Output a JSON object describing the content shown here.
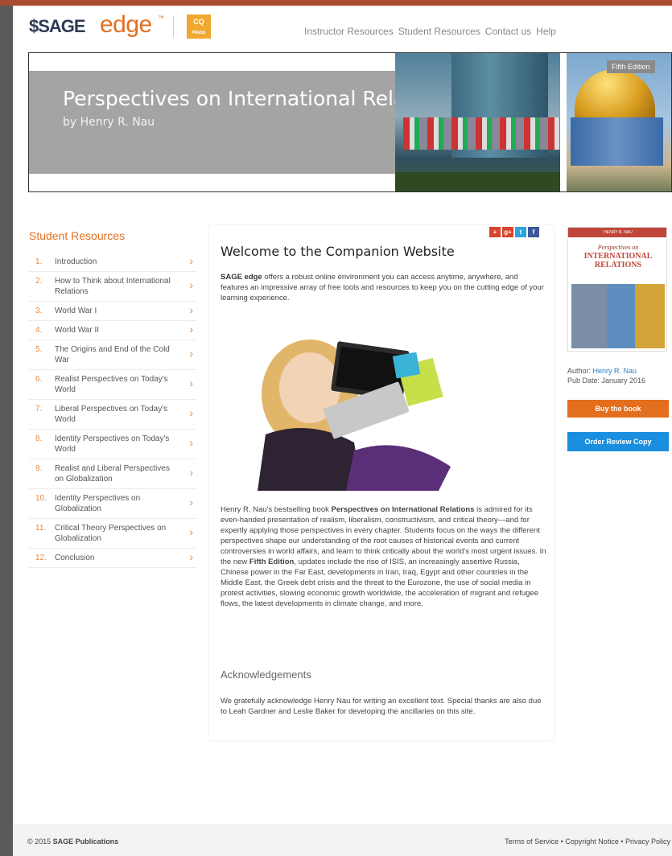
{
  "header": {
    "brand_sage": "SAGE",
    "brand_edge": "edge",
    "brand_tm": "™",
    "cq_logo": "CQ PRESS",
    "nav": [
      "Instructor Resources",
      "Student Resources",
      "Contact us",
      "Help"
    ]
  },
  "hero": {
    "title": "Perspectives on International Relations",
    "author": "by Henry R. Nau",
    "edition": "Fifth Edition"
  },
  "sidebar": {
    "title": "Student Resources",
    "items": [
      {
        "num": "1.",
        "label": "Introduction"
      },
      {
        "num": "2.",
        "label": "How to Think about International Relations"
      },
      {
        "num": "3.",
        "label": "World War I"
      },
      {
        "num": "4.",
        "label": "World War II"
      },
      {
        "num": "5.",
        "label": "The Origins and End of the Cold War"
      },
      {
        "num": "6.",
        "label": "Realist Perspectives on Today's World"
      },
      {
        "num": "7.",
        "label": "Liberal Perspectives on Today's World"
      },
      {
        "num": "8.",
        "label": "Identity Perspectives on Today's World"
      },
      {
        "num": "9.",
        "label": "Realist and Liberal Perspectives on Globalization"
      },
      {
        "num": "10.",
        "label": "Identity Perspectives on Globalization"
      },
      {
        "num": "11.",
        "label": "Critical Theory Perspectives on Globalization"
      },
      {
        "num": "12.",
        "label": "Conclusion"
      }
    ]
  },
  "main": {
    "welcome_title": "Welcome to the Companion Website",
    "intro_bold": "SAGE edge",
    "intro_text": " offers a robust online environment you can access anytime, anywhere, and features an impressive array of free tools and resources to keep you on the cutting edge of your learning experience.",
    "para_1": "Henry R. Nau's bestselling book ",
    "para_bold_1": "Perspectives on International Relations",
    "para_2": " is admired for its even-handed presentation of realism, liberalism, constructivism, and critical theory—and for expertly applying those perspectives in every chapter. Students focus on the ways the different perspectives shape our understanding of the root causes of historical events and current controversies in world affairs, and learn to think critically about the world's most urgent issues. In the new ",
    "para_bold_2": "Fifth Edition",
    "para_3": ", updates include the rise of ISIS, an increasingly assertive Russia, Chinese power in the Far East, developments in Iran, Iraq, Egypt and other countries in the Middle East, the Greek debt crisis and the threat to the Eurozone, the use of social media in protest activities, slowing economic growth worldwide, the acceleration of migrant and refugee flows, the latest developments in climate change, and more.",
    "ack_title": "Acknowledgements",
    "ack_text": "We gratefully acknowledge Henry Nau for writing an excellent text. Special thanks are also due to Leah Gardner and Leslie Baker for developing the ancillaries on this site."
  },
  "share": {
    "icons": [
      "+",
      "g+",
      "t",
      "f"
    ],
    "colors": [
      "#d9432b",
      "#d9432b",
      "#2aa3e0",
      "#3b5998"
    ]
  },
  "book": {
    "cover_top": "HENRY R. NAU",
    "cover_title_1": "Perspectives on",
    "cover_title_2": "INTERNATIONAL RELATIONS",
    "author_label": "Author: ",
    "author_name": "Henry R. Nau",
    "pub_date": "Pub Date: January 2016",
    "buy_label": "Buy the book",
    "order_label": "Order Review Copy"
  },
  "footer": {
    "copyright_prefix": "© 2015 ",
    "copyright_brand": "SAGE Publications",
    "links": "Terms of Service • Copyright Notice • Privacy Policy"
  },
  "colors": {
    "accent_orange": "#e36f1e",
    "accent_blue": "#1a8fe0",
    "top_bar": "#a94b2f"
  }
}
